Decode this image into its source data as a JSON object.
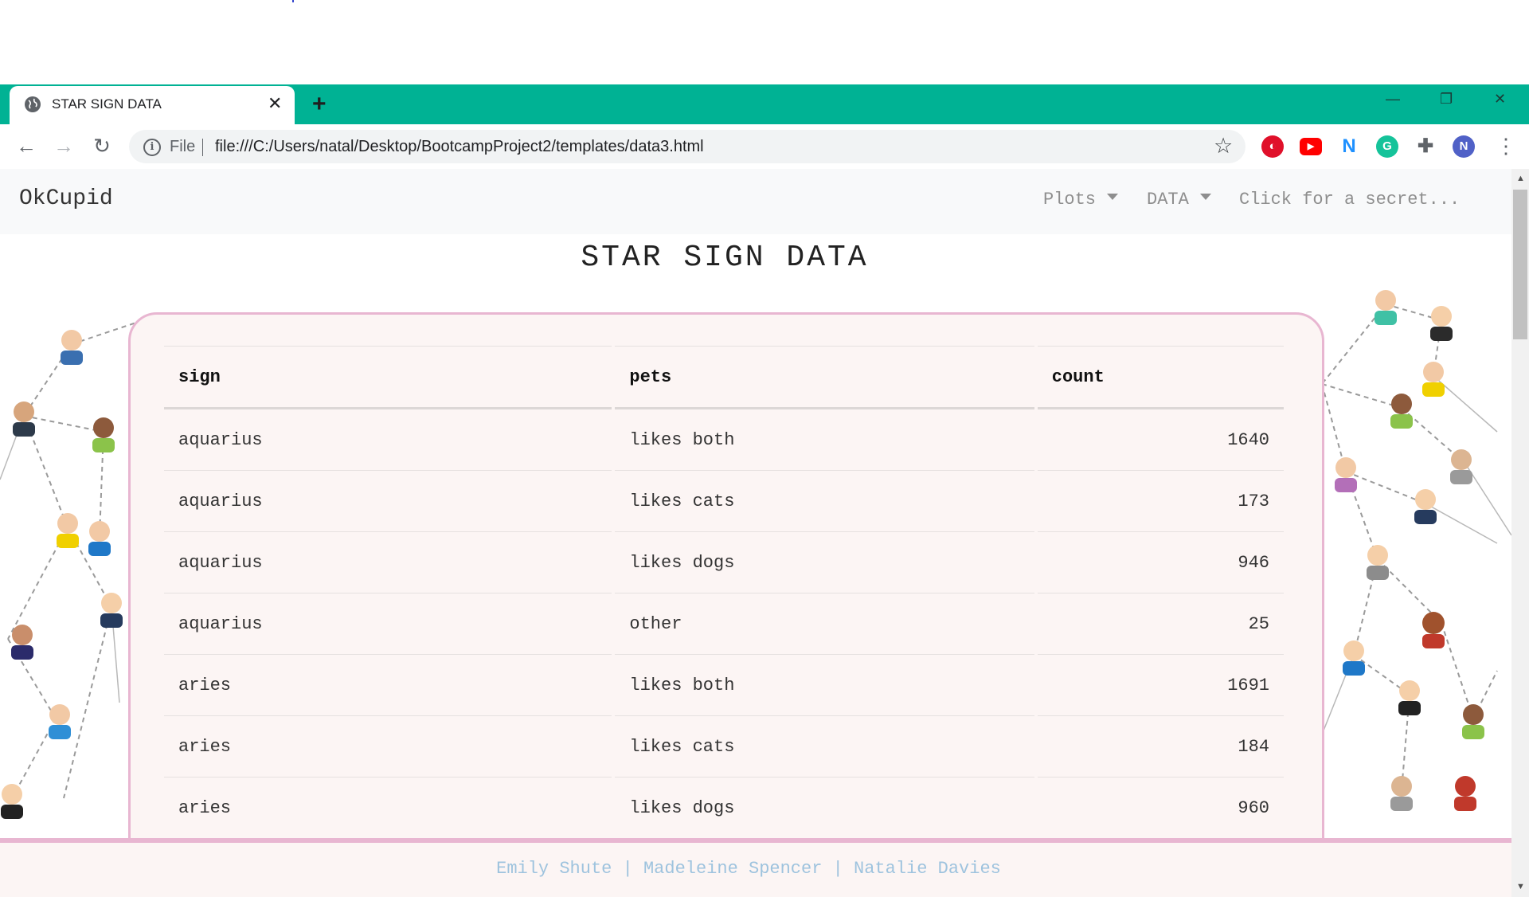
{
  "browser": {
    "tab_title": "STAR SIGN DATA",
    "address_scheme_label": "File",
    "url": "file:///C:/Users/natal/Desktop/BootcampProject2/templates/data3.html",
    "profile_initial": "N"
  },
  "navbar": {
    "brand": "OkCupid",
    "items": [
      {
        "label": "Plots"
      },
      {
        "label": "DATA"
      },
      {
        "label": "Click for a secret..."
      }
    ]
  },
  "page_title": "STAR SIGN DATA",
  "table": {
    "columns": [
      "sign",
      "pets",
      "count"
    ],
    "rows": [
      {
        "sign": "aquarius",
        "pets": "likes both",
        "count": "1640"
      },
      {
        "sign": "aquarius",
        "pets": "likes cats",
        "count": "173"
      },
      {
        "sign": "aquarius",
        "pets": "likes dogs",
        "count": "946"
      },
      {
        "sign": "aquarius",
        "pets": "other",
        "count": "25"
      },
      {
        "sign": "aries",
        "pets": "likes both",
        "count": "1691"
      },
      {
        "sign": "aries",
        "pets": "likes cats",
        "count": "184"
      },
      {
        "sign": "aries",
        "pets": "likes dogs",
        "count": "960"
      }
    ]
  },
  "footer": {
    "names": [
      "Emily Shute",
      "Madeleine Spencer",
      "Natalie Davies"
    ],
    "separator": "|"
  },
  "colors": {
    "tab_strip": "#00b294",
    "card_background": "#fcf5f4",
    "card_border": "#e8b6d1",
    "footer_link": "#9ec3de"
  },
  "icons": {
    "tab": "globe-icon",
    "extensions": [
      "opera-icon",
      "youtube-icon",
      "n-extension-icon",
      "grammarly-icon",
      "puzzle-icon"
    ]
  }
}
